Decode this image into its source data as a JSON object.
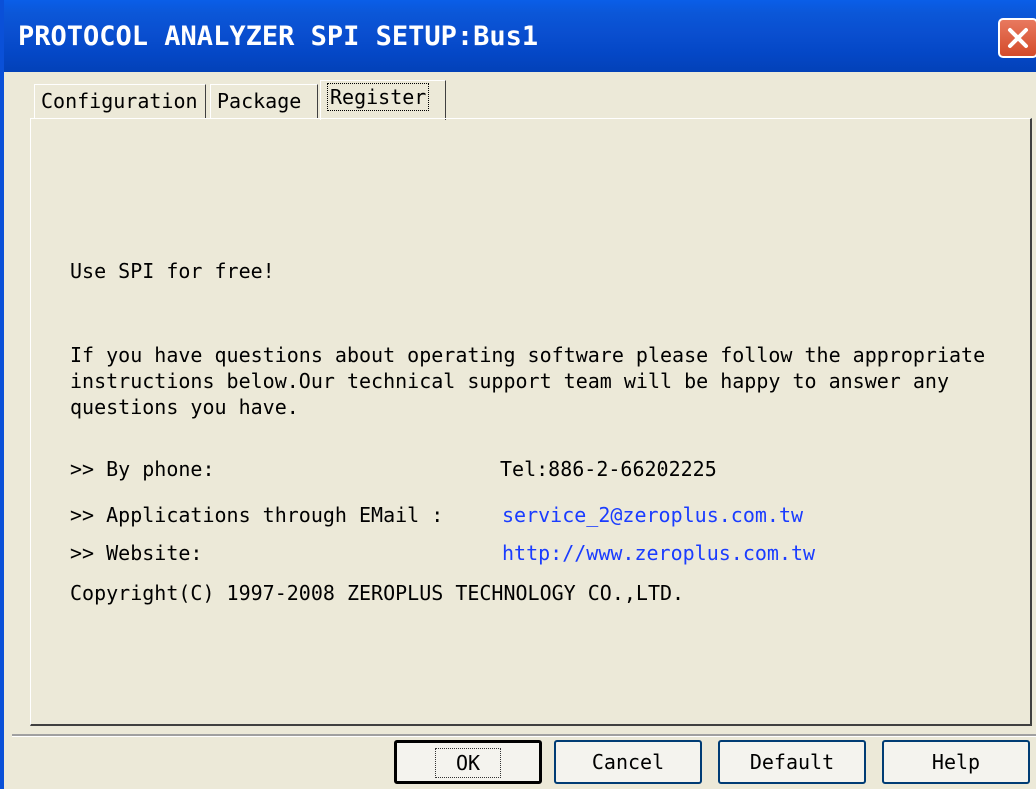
{
  "window": {
    "title": "PROTOCOL ANALYZER SPI SETUP:Bus1"
  },
  "tabs": [
    {
      "label": "Configuration",
      "active": false
    },
    {
      "label": "Package",
      "active": false
    },
    {
      "label": "Register",
      "active": true
    }
  ],
  "register": {
    "heading": "Use SPI for free!",
    "intro_lines": [
      "If you have questions about operating software please follow the appropriate",
      "instructions below.Our technical support team will be happy to answer any",
      "questions you have."
    ],
    "contacts": [
      {
        "label": ">> By phone:",
        "value": "Tel:886-2-66202225",
        "is_link": false
      },
      {
        "label": ">> Applications through EMail :",
        "value": "service_2@zeroplus.com.tw",
        "is_link": true
      },
      {
        "label": ">> Website:",
        "value": "http://www.zeroplus.com.tw",
        "is_link": true
      }
    ],
    "copyright": "Copyright(C) 1997-2008 ZEROPLUS TECHNOLOGY CO.,LTD."
  },
  "buttons": {
    "ok": "OK",
    "cancel": "Cancel",
    "default": "Default",
    "help": "Help"
  },
  "colors": {
    "titlebar": "#0a4fd0",
    "link": "#1a3cff",
    "face": "#ece9d8",
    "close": "#d44b2a"
  }
}
